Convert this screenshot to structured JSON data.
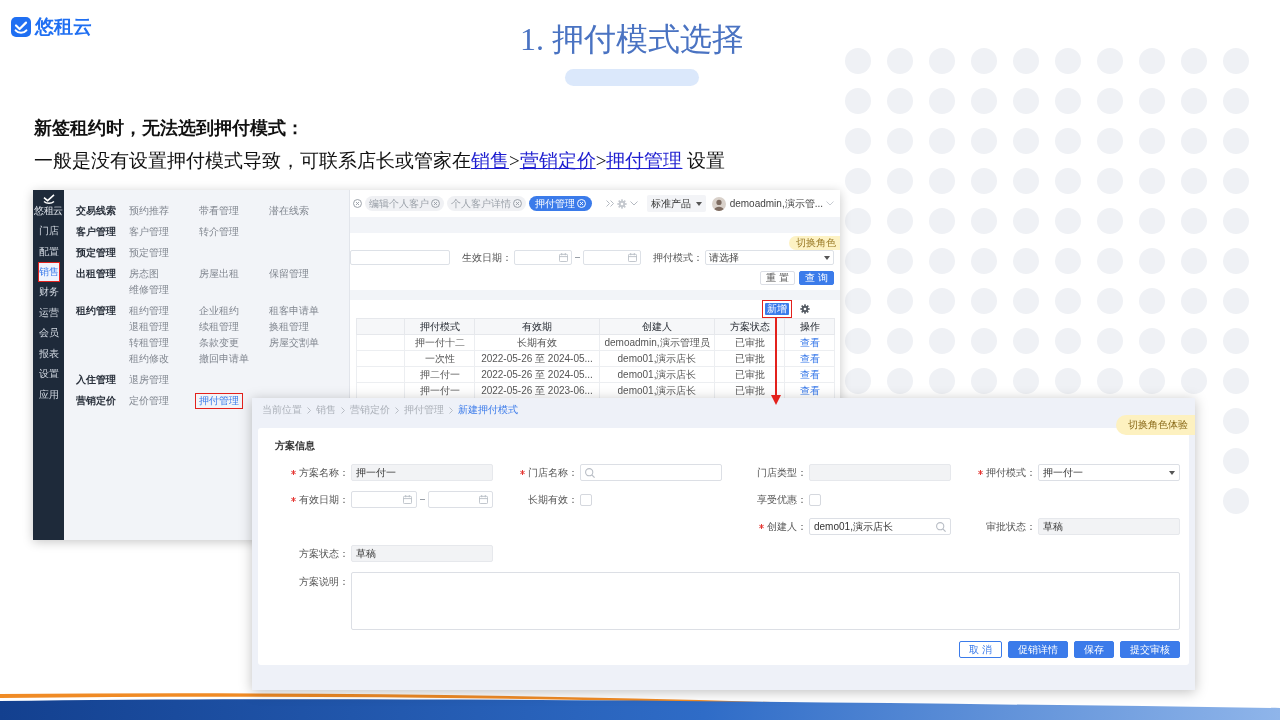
{
  "logo": {
    "text": "悠租云"
  },
  "title": "1. 押付模式选择",
  "heading": "新签租约时，无法选到押付模式：",
  "instruction": [
    {
      "kind": "text",
      "text": "一般是没有设置押付模式导致，可联系店长或管家在"
    },
    {
      "kind": "link",
      "text": "销售"
    },
    {
      "kind": "text",
      "text": ">"
    },
    {
      "kind": "link",
      "text": "营销定价"
    },
    {
      "kind": "text",
      "text": ">"
    },
    {
      "kind": "link",
      "text": "押付管理"
    },
    {
      "kind": "text",
      "text": " 设置"
    }
  ],
  "list_screenshot": {
    "sidebar": {
      "logo": "悠租云",
      "items": [
        {
          "label": "门店",
          "selected": false,
          "annotated": false
        },
        {
          "label": "配置",
          "selected": false,
          "annotated": false
        },
        {
          "label": "销售",
          "selected": true,
          "annotated": true
        },
        {
          "label": "财务",
          "selected": false,
          "annotated": false
        },
        {
          "label": "运营",
          "selected": false,
          "annotated": false
        },
        {
          "label": "会员",
          "selected": false,
          "annotated": false
        },
        {
          "label": "报表",
          "selected": false,
          "annotated": false
        },
        {
          "label": "设置",
          "selected": false,
          "annotated": false
        },
        {
          "label": "应用",
          "selected": false,
          "annotated": false
        }
      ]
    },
    "menu": {
      "groups": [
        {
          "title": "交易线索",
          "links": [
            {
              "label": "预约推荐",
              "selected": false,
              "annotated": false
            },
            {
              "label": "带看管理",
              "selected": false,
              "annotated": false
            },
            {
              "label": "潜在线索",
              "selected": false,
              "annotated": false
            }
          ]
        },
        {
          "title": "客户管理",
          "links": [
            {
              "label": "客户管理",
              "selected": false,
              "annotated": false
            },
            {
              "label": "转介管理",
              "selected": false,
              "annotated": false
            }
          ]
        },
        {
          "title": "预定管理",
          "links": [
            {
              "label": "预定管理",
              "selected": false,
              "annotated": false
            }
          ]
        },
        {
          "title": "出租管理",
          "links": [
            {
              "label": "房态图",
              "selected": false,
              "annotated": false
            },
            {
              "label": "房屋出租",
              "selected": false,
              "annotated": false
            },
            {
              "label": "保留管理",
              "selected": false,
              "annotated": false
            },
            {
              "label": "维修管理",
              "selected": false,
              "annotated": false
            }
          ]
        },
        {
          "title": "租约管理",
          "links": [
            {
              "label": "租约管理",
              "selected": false,
              "annotated": false
            },
            {
              "label": "企业租约",
              "selected": false,
              "annotated": false
            },
            {
              "label": "租客申请单",
              "selected": false,
              "annotated": false
            },
            {
              "label": "退租管理",
              "selected": false,
              "annotated": false
            },
            {
              "label": "续租管理",
              "selected": false,
              "annotated": false
            },
            {
              "label": "换租管理",
              "selected": false,
              "annotated": false
            },
            {
              "label": "转租管理",
              "selected": false,
              "annotated": false
            },
            {
              "label": "条款变更",
              "selected": false,
              "annotated": false
            },
            {
              "label": "房屋交割单",
              "selected": false,
              "annotated": false
            },
            {
              "label": "租约修改",
              "selected": false,
              "annotated": false
            },
            {
              "label": "撤回申请单",
              "selected": false,
              "annotated": false
            }
          ]
        },
        {
          "title": "入住管理",
          "links": [
            {
              "label": "退房管理",
              "selected": false,
              "annotated": false
            }
          ]
        },
        {
          "title": "营销定价",
          "links": [
            {
              "label": "定价管理",
              "selected": false,
              "annotated": false
            },
            {
              "label": "押付管理",
              "selected": true,
              "annotated": true
            }
          ]
        }
      ]
    },
    "tabs": [
      {
        "label": "编辑个人客户",
        "selected": false
      },
      {
        "label": "个人客户详情",
        "selected": false
      },
      {
        "label": "押付管理",
        "selected": true
      }
    ],
    "product_select": "标准产品",
    "user_name": "demoadmin,演示管...",
    "role_badge": "切换角色",
    "filters": [
      {
        "kind": "text"
      },
      {
        "kind": "daterange",
        "label": "生效日期："
      },
      {
        "kind": "select",
        "label": "押付模式：",
        "placeholder": "请选择"
      }
    ],
    "filter_buttons": [
      {
        "label": "重 置",
        "kind": "default"
      },
      {
        "label": "查 询",
        "kind": "primary"
      }
    ],
    "add_button": {
      "label": "新增",
      "annotated": true
    },
    "table": {
      "columns": [
        "押付模式",
        "有效期",
        "创建人",
        "方案状态",
        "操作"
      ],
      "rows": [
        [
          "押一付十二",
          "长期有效",
          "demoadmin,演示管理员",
          "已审批",
          "查看"
        ],
        [
          "一次性",
          "2022-05-26 至 2024-05...",
          "demo01,演示店长",
          "已审批",
          "查看"
        ],
        [
          "押二付一",
          "2022-05-26 至 2024-05...",
          "demo01,演示店长",
          "已审批",
          "查看"
        ],
        [
          "押一付一",
          "2022-05-26 至 2023-06...",
          "demo01,演示店长",
          "已审批",
          "查看"
        ]
      ]
    }
  },
  "form_screenshot": {
    "breadcrumb": [
      {
        "label": "当前位置",
        "current": false
      },
      {
        "label": "销售",
        "current": false
      },
      {
        "label": "营销定价",
        "current": false
      },
      {
        "label": "押付管理",
        "current": false
      },
      {
        "label": "新建押付模式",
        "current": true
      }
    ],
    "role_badge": "切换角色体验",
    "section_title": "方案信息",
    "fields": [
      {
        "label": "方案名称：",
        "required": true,
        "kind": "text",
        "value": "押一付一",
        "disabled": true
      },
      {
        "label": "门店名称：",
        "required": true,
        "kind": "search",
        "disabled": false
      },
      {
        "label": "门店类型：",
        "required": false,
        "kind": "text",
        "disabled": true
      },
      {
        "label": "押付模式：",
        "required": true,
        "kind": "select",
        "value": "押一付一",
        "disabled": false
      },
      {
        "label": "有效日期：",
        "required": true,
        "kind": "daterange",
        "disabled": false
      },
      {
        "label": "长期有效：",
        "required": false,
        "kind": "checkbox",
        "checked": false,
        "disabled": false
      },
      {
        "label": "享受优惠：",
        "required": false,
        "kind": "checkbox",
        "checked": false,
        "disabled": false
      },
      {
        "label": "创建人：",
        "required": true,
        "kind": "search",
        "value": "demo01,演示店长",
        "disabled": false
      },
      {
        "label": "审批状态：",
        "required": false,
        "kind": "text",
        "value": "草稿",
        "disabled": true
      },
      {
        "label": "方案状态：",
        "required": false,
        "kind": "text",
        "value": "草稿",
        "disabled": true
      },
      {
        "label": "方案说明：",
        "required": false,
        "kind": "textarea",
        "disabled": false
      }
    ],
    "buttons": [
      {
        "label": "取 消",
        "kind": "outline"
      },
      {
        "label": "促销详情",
        "kind": "primary"
      },
      {
        "label": "保存",
        "kind": "primary"
      },
      {
        "label": "提交审核",
        "kind": "primary"
      }
    ]
  }
}
